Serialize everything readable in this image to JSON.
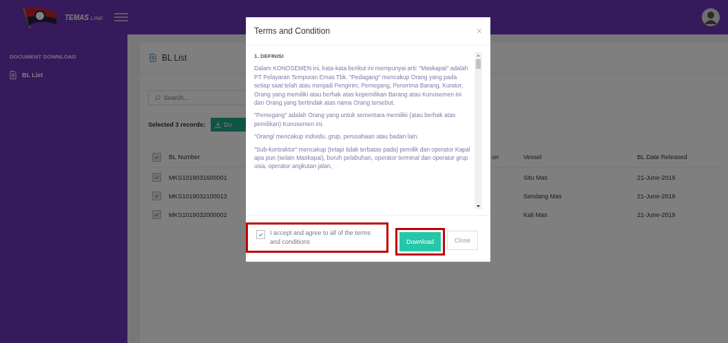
{
  "topbar": {
    "brand": "TEMAS",
    "brand_suffix": "LINE"
  },
  "sidebar": {
    "section": "DOCUMENT DOWNLOAD",
    "items": [
      {
        "label": "BL List",
        "selected": true
      }
    ]
  },
  "card": {
    "title": "BL List",
    "search": {
      "placeholder": "Search..."
    },
    "selection_text": "Selected 3 records:",
    "bulk_button": "Do",
    "table": {
      "columns": [
        "BL Number",
        "on",
        "Vessel",
        "BL Date Released"
      ],
      "all_checked": true,
      "rows": [
        {
          "checked": true,
          "bl_number": "MKS1019031600001",
          "vessel": "Situ Mas",
          "date": "21-June-2019"
        },
        {
          "checked": true,
          "bl_number": "MKS1019032100013",
          "vessel": "Sendang Mas",
          "date": "21-June-2019"
        },
        {
          "checked": true,
          "bl_number": "MKS1019032000002",
          "vessel": "Kali Mas",
          "date": "21-June-2019"
        }
      ]
    }
  },
  "modal": {
    "title": "Terms and Condition",
    "close": "×",
    "heading": "1. DEFINISI",
    "paragraphs": [
      "Dalam KONOSEMEN ini, kata-kata berikut ini mempunyai arti: \"Maskapai\" adalah PT Pelayaran Tempuran Emas Tbk. \"Pedagang\" mencakup Orang yang pada setiap saat telah atau menjadi Pengirim, Pemegang, Penerima Barang, Kurator, Orang yang memiliki atau berhak atas kepemilikan Barang atau Konosemen ini dan Orang yang bertindak atas nama Orang tersebut.",
      "\"Pemegang\" adalah Orang yang untuk sementara memiliki (atau berhak atas pemilikan) Konosemen ini.",
      "\"Orang/ mencakup individu, grup, perusahaan atau badan lain.",
      "\"Sub-kontraktor\" mencakup (tetapi tidak terbatas pada) pemilik dan operator Kapal apa pun (selain Maskapai), buruh pelabuhan, operator terminal dan operator grup usia, operator angkutan jalan,"
    ],
    "accept": {
      "label": "I accept and agree to all of the terms and conditions",
      "checked": true,
      "highlighted": true
    },
    "buttons": [
      {
        "label": "Download",
        "kind": "primary",
        "highlighted": true
      },
      {
        "label": "Close",
        "kind": "secondary",
        "highlighted": false
      }
    ]
  }
}
